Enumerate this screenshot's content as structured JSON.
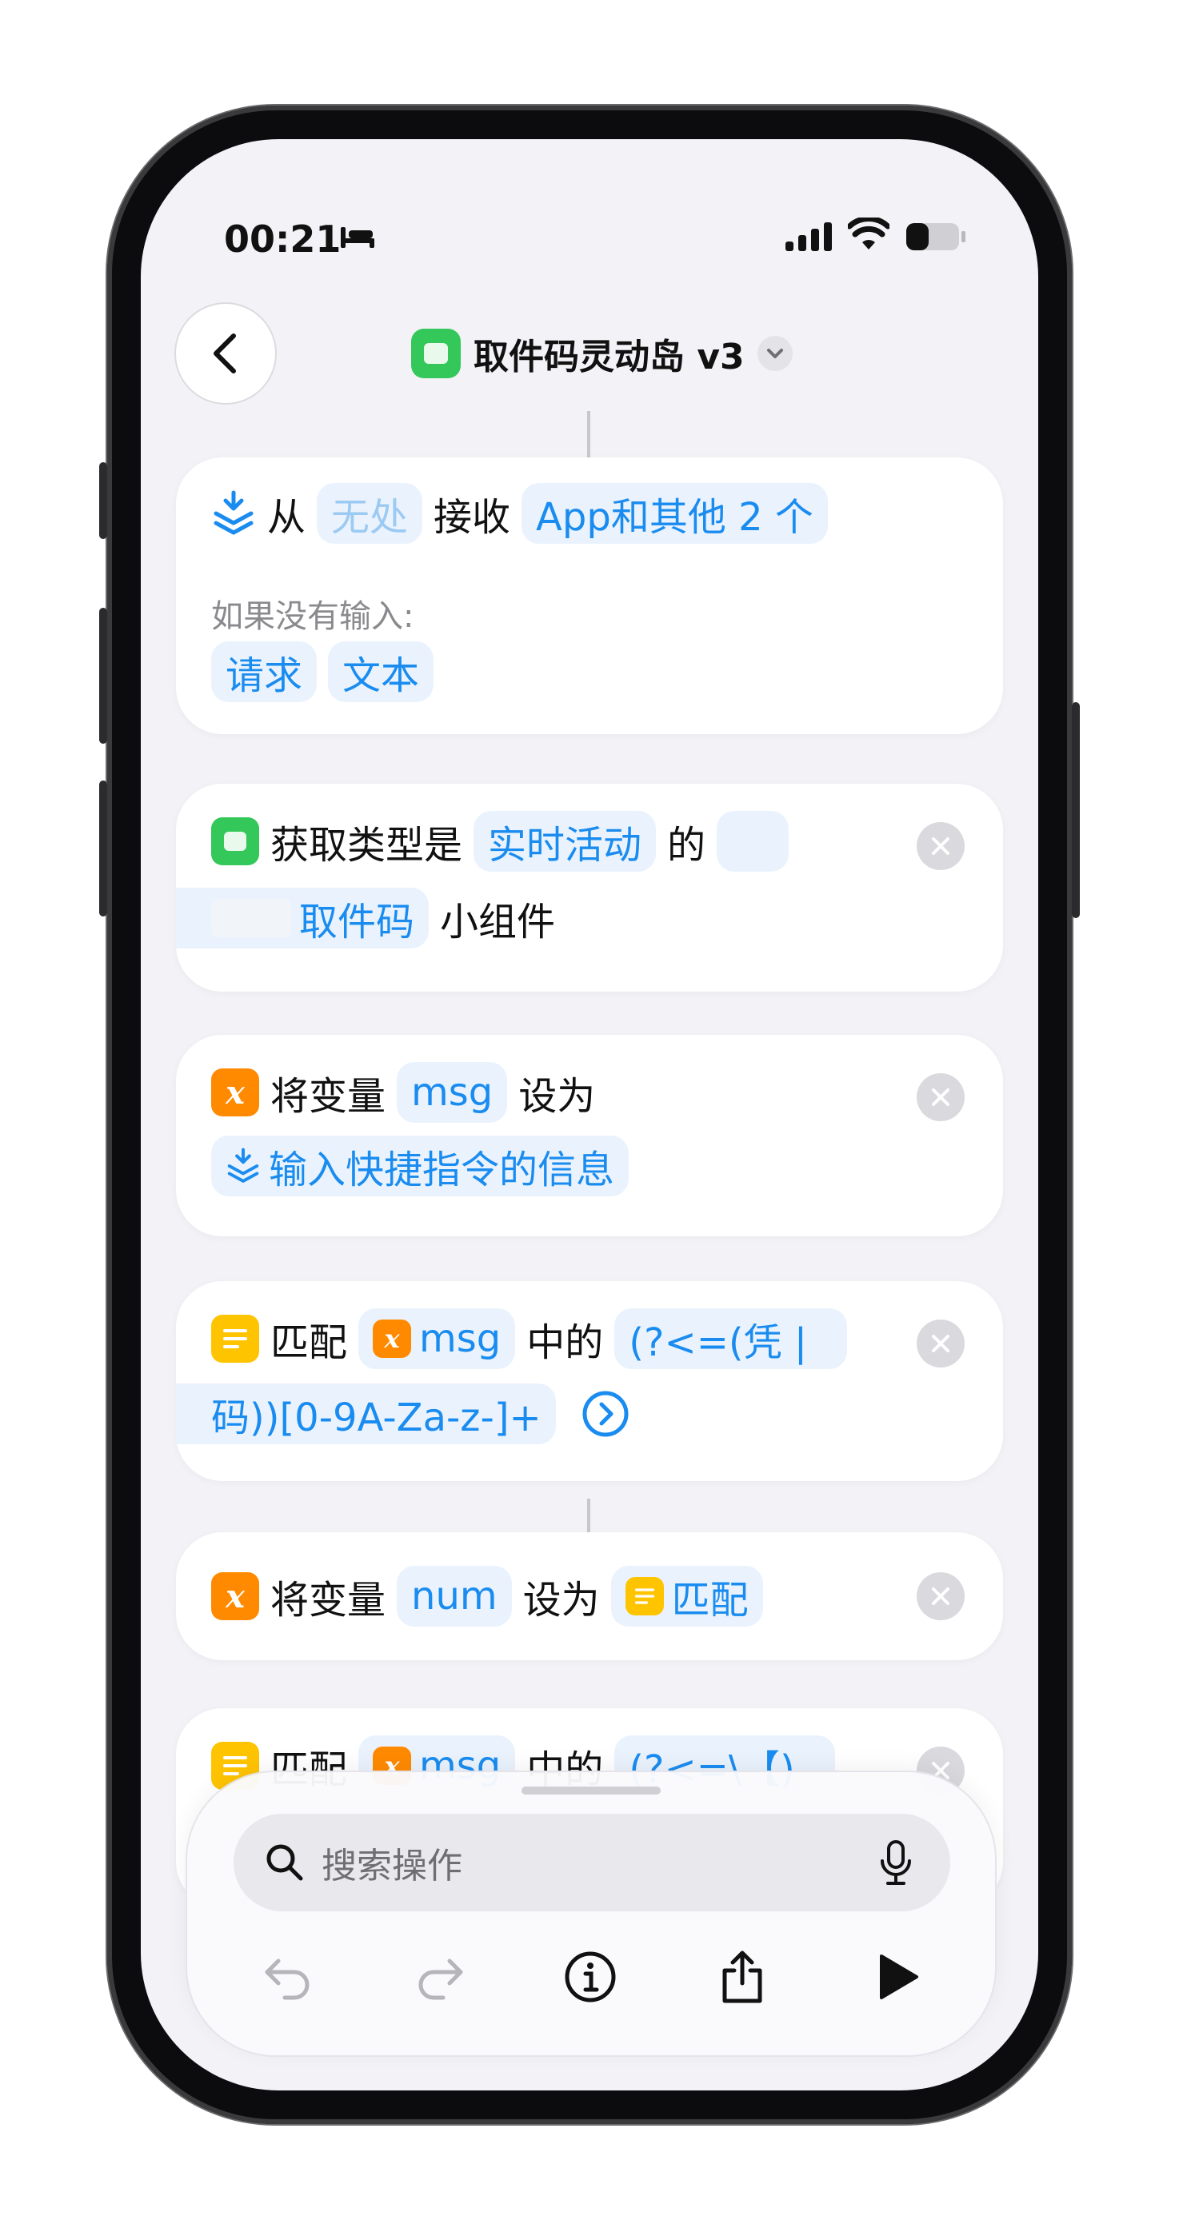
{
  "status": {
    "time": "00:21"
  },
  "nav": {
    "title": "取件码灵动岛 v3"
  },
  "cards": {
    "receive": {
      "word_from": "从",
      "source": "无处",
      "word_receive": "接收",
      "types": "App和其他 2 个",
      "if_no_input": "如果没有输入:",
      "opt1": "请求",
      "opt2": "文本"
    },
    "get_widget": {
      "text1": "获取类型是",
      "type": "实时活动",
      "text2": "的",
      "name": "取件码",
      "text3": "小组件"
    },
    "set_msg": {
      "text1": "将变量",
      "var": "msg",
      "text2": "设为",
      "value": "输入快捷指令的信息"
    },
    "match1": {
      "text1": "匹配",
      "var": "msg",
      "text2": "中的",
      "pattern_a": "(?<=(凭 |",
      "pattern_b": "码))[0-9A-Za-z-]+"
    },
    "set_num": {
      "text1": "将变量",
      "var": "num",
      "text2": "设为",
      "value": "匹配"
    },
    "match2": {
      "text1": "匹配",
      "var": "msg",
      "text2": "中的",
      "pattern": "(?<=\\【)"
    }
  },
  "toolbar": {
    "search_placeholder": "搜索操作"
  },
  "colors": {
    "accent": "#1a8cf0",
    "token_bg": "#eaf3fd",
    "green": "#34c759",
    "orange": "#ff8a00",
    "yellow": "#ffc400"
  }
}
